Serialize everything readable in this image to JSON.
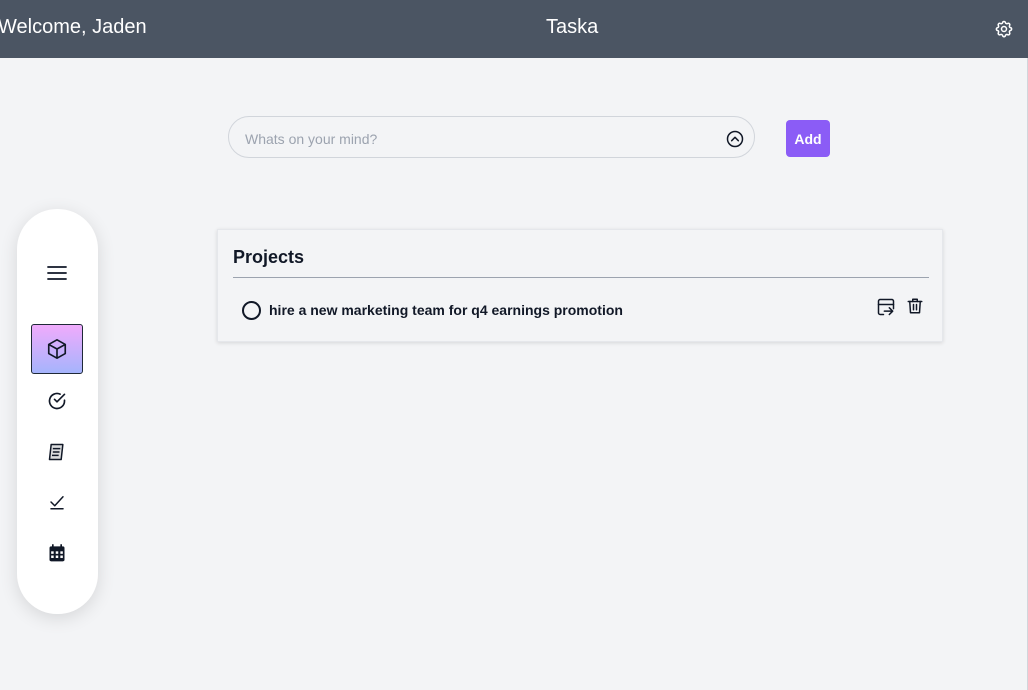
{
  "header": {
    "welcome": "Welcome, Jaden",
    "title": "Taska",
    "settings_icon": "gear-icon"
  },
  "input": {
    "placeholder": "Whats on your mind?",
    "value": "",
    "dropdown_icon": "chevron-up-circle-icon",
    "add_label": "Add"
  },
  "sidebar": {
    "items": [
      {
        "icon": "hamburger-menu-icon",
        "active": false
      },
      {
        "icon": "cube-icon",
        "active": true
      },
      {
        "icon": "check-circle-icon",
        "active": false
      },
      {
        "icon": "notes-icon",
        "active": false
      },
      {
        "icon": "checkmark-icon",
        "active": false
      },
      {
        "icon": "calendar-icon",
        "active": false
      }
    ],
    "active_gradient": [
      "#f0abfc",
      "#a5b4fc"
    ]
  },
  "projects": {
    "title": "Projects",
    "tasks": [
      {
        "text": "hire a new marketing team for q4 earnings promotion",
        "completed": false,
        "actions": [
          "move-icon",
          "trash-icon"
        ]
      }
    ]
  },
  "colors": {
    "header_bg": "#4b5563",
    "page_bg": "#f3f4f6",
    "accent": "#8b5cf6"
  }
}
